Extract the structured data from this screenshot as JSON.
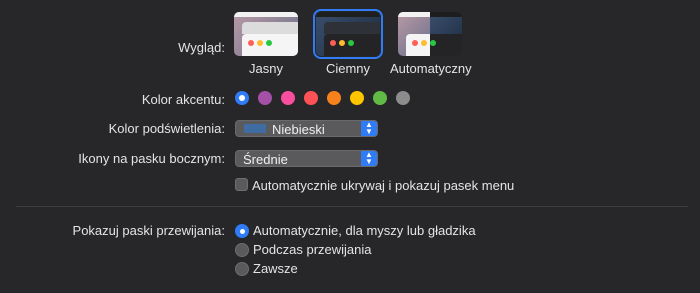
{
  "appearance": {
    "label": "Wygląd:",
    "options": [
      {
        "label": "Jasny",
        "theme": "light"
      },
      {
        "label": "Ciemny",
        "theme": "dark",
        "selected": true
      },
      {
        "label": "Automatyczny",
        "theme": "auto"
      }
    ]
  },
  "accent": {
    "label": "Kolor akcentu:",
    "colors": [
      "#2f7cf6",
      "#a550a7",
      "#f74f9e",
      "#ff5257",
      "#f7821b",
      "#ffc600",
      "#62ba46",
      "#8c8c8c"
    ],
    "selected_index": 0
  },
  "highlight": {
    "label": "Kolor podświetlenia:",
    "value": "Niebieski",
    "swatch_color": "#3f6da3"
  },
  "sidebar_icons": {
    "label": "Ikony na pasku bocznym:",
    "value": "Średnie"
  },
  "menubar_checkbox": {
    "label": "Automatycznie ukrywaj i pokazuj pasek menu",
    "checked": false
  },
  "scrollbars": {
    "label": "Pokazuj paski przewijania:",
    "options": [
      {
        "label": "Automatycznie, dla myszy lub gładzika",
        "selected": true
      },
      {
        "label": "Podczas przewijania",
        "selected": false
      },
      {
        "label": "Zawsze",
        "selected": false
      }
    ]
  }
}
